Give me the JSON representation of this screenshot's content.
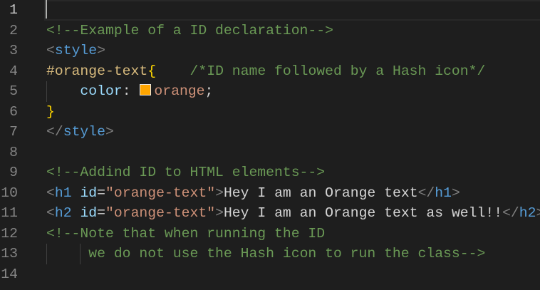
{
  "editor": {
    "active_line": 1,
    "swatch_color": "#ffa500",
    "lines": [
      {
        "number": "1",
        "tokens": []
      },
      {
        "number": "2",
        "tokens": [
          {
            "t": "<!--Example of a ID declaration-->",
            "c": "comment"
          }
        ]
      },
      {
        "number": "3",
        "tokens": [
          {
            "t": "<",
            "c": "punct"
          },
          {
            "t": "style",
            "c": "tag"
          },
          {
            "t": ">",
            "c": "punct"
          }
        ]
      },
      {
        "number": "4",
        "tokens": [
          {
            "t": "#orange-text",
            "c": "sel"
          },
          {
            "t": "{",
            "c": "brace"
          },
          {
            "t": "    ",
            "c": "text"
          },
          {
            "t": "/*ID name followed by a Hash icon*/",
            "c": "comment"
          }
        ]
      },
      {
        "number": "5",
        "guides": [
          0
        ],
        "tokens": [
          {
            "t": "    ",
            "c": "text"
          },
          {
            "t": "color",
            "c": "prop"
          },
          {
            "t": ": ",
            "c": "text"
          },
          {
            "t": "",
            "c": "swatch"
          },
          {
            "t": "orange",
            "c": "val"
          },
          {
            "t": ";",
            "c": "text"
          }
        ]
      },
      {
        "number": "6",
        "tokens": [
          {
            "t": "}",
            "c": "brace"
          }
        ]
      },
      {
        "number": "7",
        "tokens": [
          {
            "t": "</",
            "c": "punct"
          },
          {
            "t": "style",
            "c": "tag"
          },
          {
            "t": ">",
            "c": "punct"
          }
        ]
      },
      {
        "number": "8",
        "tokens": []
      },
      {
        "number": "9",
        "tokens": [
          {
            "t": "<!--Addind ID to HTML elements-->",
            "c": "comment"
          }
        ]
      },
      {
        "number": "10",
        "tokens": [
          {
            "t": "<",
            "c": "punct"
          },
          {
            "t": "h1",
            "c": "tag"
          },
          {
            "t": " ",
            "c": "text"
          },
          {
            "t": "id",
            "c": "attr"
          },
          {
            "t": "=",
            "c": "text"
          },
          {
            "t": "\"orange-text\"",
            "c": "str"
          },
          {
            "t": ">",
            "c": "punct"
          },
          {
            "t": "Hey I am an Orange text",
            "c": "text"
          },
          {
            "t": "</",
            "c": "punct"
          },
          {
            "t": "h1",
            "c": "tag"
          },
          {
            "t": ">",
            "c": "punct"
          }
        ]
      },
      {
        "number": "11",
        "tokens": [
          {
            "t": "<",
            "c": "punct"
          },
          {
            "t": "h2",
            "c": "tag"
          },
          {
            "t": " ",
            "c": "text"
          },
          {
            "t": "id",
            "c": "attr"
          },
          {
            "t": "=",
            "c": "text"
          },
          {
            "t": "\"orange-text\"",
            "c": "str"
          },
          {
            "t": ">",
            "c": "punct"
          },
          {
            "t": "Hey I am an Orange text as well!!",
            "c": "text"
          },
          {
            "t": "</",
            "c": "punct"
          },
          {
            "t": "h2",
            "c": "tag"
          },
          {
            "t": ">",
            "c": "punct"
          }
        ]
      },
      {
        "number": "12",
        "tokens": [
          {
            "t": "<!--Note that when running the ID",
            "c": "comment"
          }
        ]
      },
      {
        "number": "13",
        "guides": [
          0,
          4
        ],
        "tokens": [
          {
            "t": "     ",
            "c": "text"
          },
          {
            "t": "we do not use the Hash icon to run the class-->",
            "c": "comment"
          }
        ]
      },
      {
        "number": "14",
        "tokens": []
      }
    ]
  }
}
